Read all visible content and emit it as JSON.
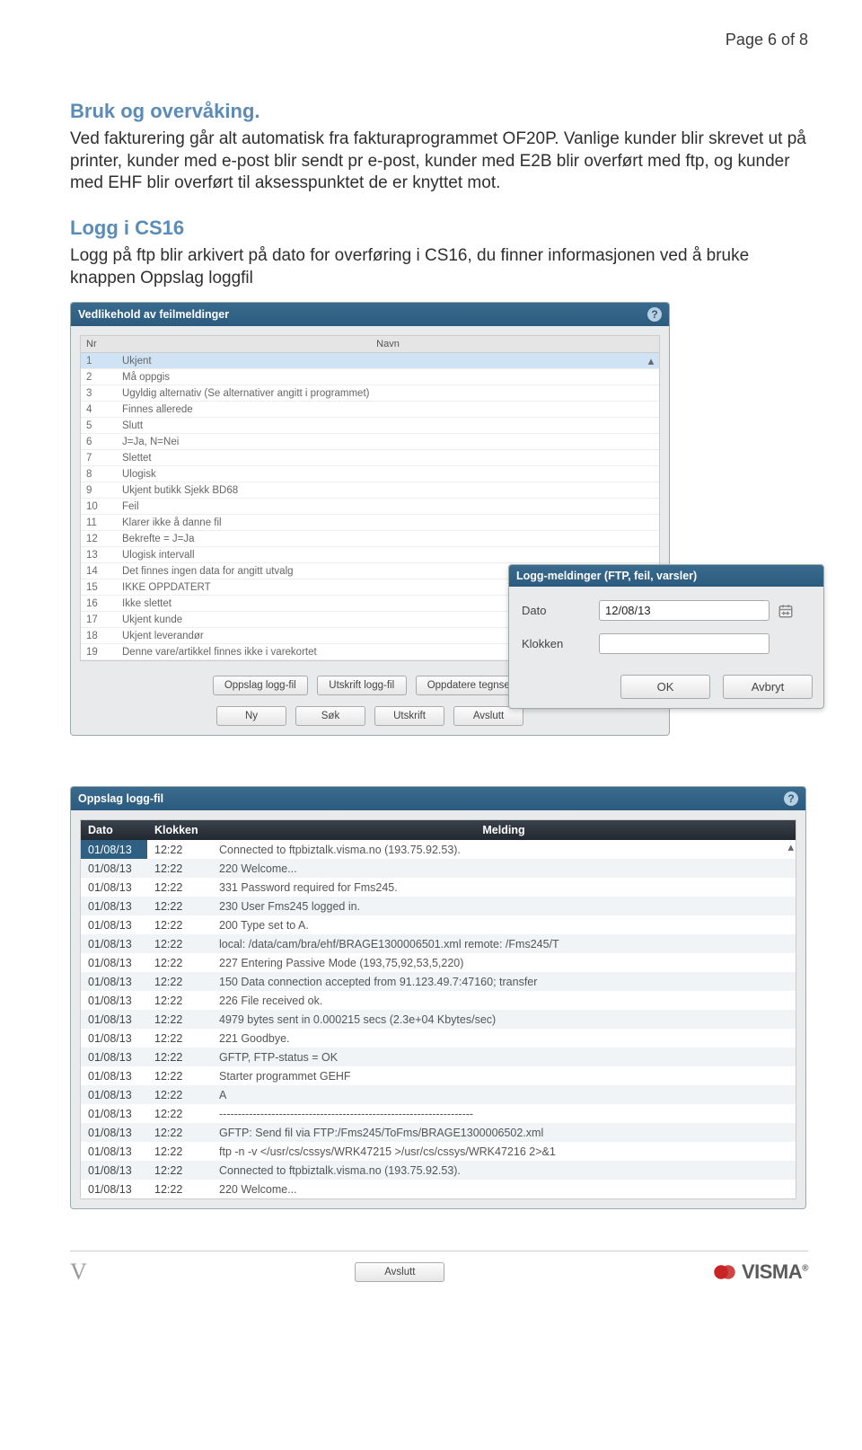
{
  "page_number": "Page 6 of 8",
  "section1": {
    "heading": "Bruk og overvåking.",
    "para": "Ved fakturering går alt automatisk fra fakturaprogrammet OF20P. Vanlige kunder blir skrevet ut på printer, kunder med e-post blir sendt pr e-post, kunder med E2B blir overført med ftp, og kunder med EHF blir overført til aksesspunktet de er knyttet mot."
  },
  "section2": {
    "heading": "Logg i CS16",
    "para": "Logg på ftp blir arkivert på dato for overføring i CS16, du finner informasjonen ved å bruke knappen Oppslag loggfil"
  },
  "dlg1": {
    "title": "Vedlikehold av feilmeldinger",
    "cols": {
      "nr": "Nr",
      "navn": "Navn"
    },
    "rows": [
      {
        "nr": "1",
        "navn": "Ukjent"
      },
      {
        "nr": "2",
        "navn": "Må oppgis"
      },
      {
        "nr": "3",
        "navn": "Ugyldig alternativ (Se alternativer angitt i programmet)"
      },
      {
        "nr": "4",
        "navn": "Finnes allerede"
      },
      {
        "nr": "5",
        "navn": "Slutt"
      },
      {
        "nr": "6",
        "navn": "J=Ja, N=Nei"
      },
      {
        "nr": "7",
        "navn": "Slettet"
      },
      {
        "nr": "8",
        "navn": "Ulogisk"
      },
      {
        "nr": "9",
        "navn": "Ukjent butikk Sjekk BD68"
      },
      {
        "nr": "10",
        "navn": "Feil"
      },
      {
        "nr": "11",
        "navn": "Klarer ikke å danne fil"
      },
      {
        "nr": "12",
        "navn": "Bekrefte = J=Ja"
      },
      {
        "nr": "13",
        "navn": "Ulogisk intervall"
      },
      {
        "nr": "14",
        "navn": "Det finnes ingen data for angitt utvalg"
      },
      {
        "nr": "15",
        "navn": "IKKE OPPDATERT"
      },
      {
        "nr": "16",
        "navn": "Ikke slettet"
      },
      {
        "nr": "17",
        "navn": "Ukjent kunde"
      },
      {
        "nr": "18",
        "navn": "Ukjent leverandør"
      },
      {
        "nr": "19",
        "navn": "Denne vare/artikkel finnes ikke i varekortet"
      }
    ],
    "btns1": {
      "oppslag": "Oppslag logg-fil",
      "utskrift": "Utskrift logg-fil",
      "oppdater": "Oppdatere tegnsett"
    },
    "btns2": {
      "ny": "Ny",
      "sok": "Søk",
      "utskrift2": "Utskrift",
      "avslutt": "Avslutt"
    }
  },
  "dlg_small": {
    "title": "Logg-meldinger (FTP, feil, varsler)",
    "label_dato": "Dato",
    "value_dato": "12/08/13",
    "label_klokken": "Klokken",
    "value_klokken": "",
    "ok": "OK",
    "avbryt": "Avbryt"
  },
  "dlg2": {
    "title": "Oppslag logg-fil",
    "cols": {
      "dato": "Dato",
      "klokken": "Klokken",
      "melding": "Melding"
    },
    "rows": [
      {
        "d": "01/08/13",
        "k": "12:22",
        "m": "Connected to ftpbiztalk.visma.no (193.75.92.53)."
      },
      {
        "d": "01/08/13",
        "k": "12:22",
        "m": "220 Welcome..."
      },
      {
        "d": "01/08/13",
        "k": "12:22",
        "m": "331 Password required for Fms245."
      },
      {
        "d": "01/08/13",
        "k": "12:22",
        "m": "230 User Fms245 logged in."
      },
      {
        "d": "01/08/13",
        "k": "12:22",
        "m": "200 Type set to A."
      },
      {
        "d": "01/08/13",
        "k": "12:22",
        "m": "local: /data/cam/bra/ehf/BRAGE1300006501.xml remote: /Fms245/T"
      },
      {
        "d": "01/08/13",
        "k": "12:22",
        "m": "227 Entering Passive Mode (193,75,92,53,5,220)"
      },
      {
        "d": "01/08/13",
        "k": "12:22",
        "m": "150 Data connection accepted from 91.123.49.7:47160; transfer"
      },
      {
        "d": "01/08/13",
        "k": "12:22",
        "m": "226 File received ok."
      },
      {
        "d": "01/08/13",
        "k": "12:22",
        "m": "4979 bytes sent in 0.000215 secs (2.3e+04 Kbytes/sec)"
      },
      {
        "d": "01/08/13",
        "k": "12:22",
        "m": "221 Goodbye."
      },
      {
        "d": "01/08/13",
        "k": "12:22",
        "m": "GFTP, FTP-status =  OK"
      },
      {
        "d": "01/08/13",
        "k": "12:22",
        "m": "Starter programmet GEHF"
      },
      {
        "d": "01/08/13",
        "k": "12:22",
        "m": "A"
      },
      {
        "d": "01/08/13",
        "k": "12:22",
        "m": "--------------------------------------------------------------------"
      },
      {
        "d": "01/08/13",
        "k": "12:22",
        "m": "GFTP: Send fil via FTP:/Fms245/ToFms/BRAGE1300006502.xml"
      },
      {
        "d": "01/08/13",
        "k": "12:22",
        "m": "ftp -n -v </usr/cs/cssys/WRK47215 >/usr/cs/cssys/WRK47216 2>&1"
      },
      {
        "d": "01/08/13",
        "k": "12:22",
        "m": "Connected to ftpbiztalk.visma.no (193.75.92.53)."
      },
      {
        "d": "01/08/13",
        "k": "12:22",
        "m": "220 Welcome..."
      }
    ],
    "avslutt": "Avslutt"
  },
  "logo": {
    "text": "VISMA"
  },
  "vletter": "V"
}
